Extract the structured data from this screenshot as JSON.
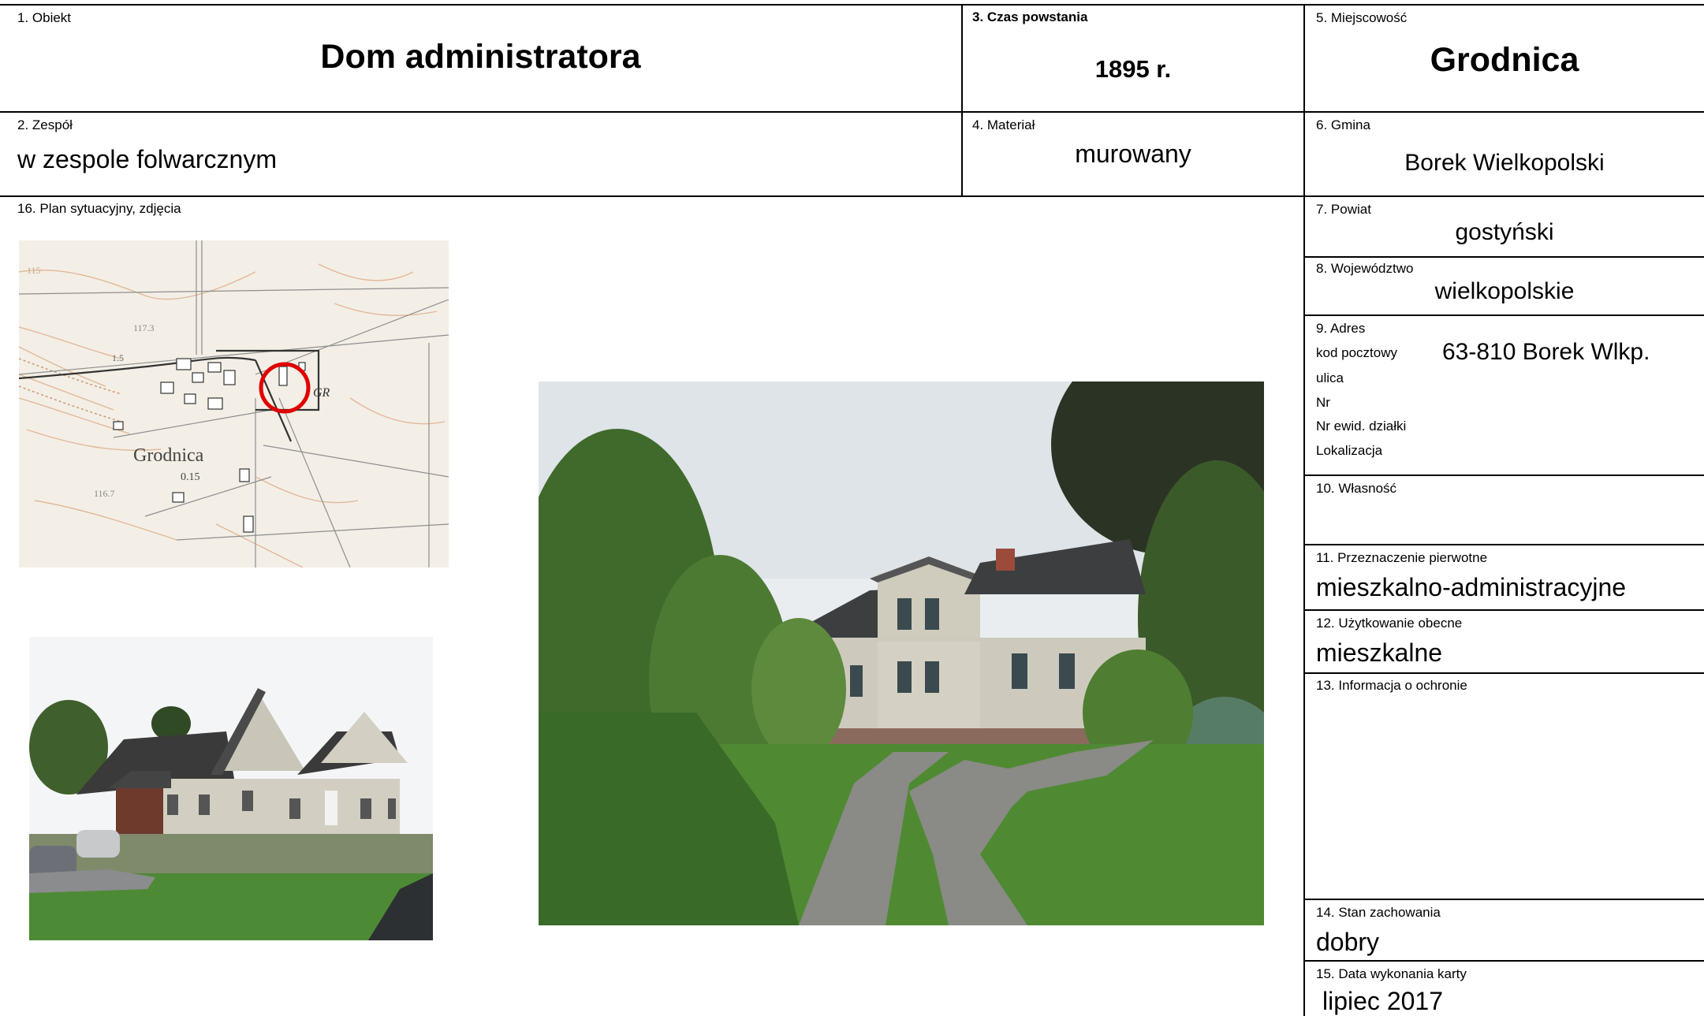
{
  "card": {
    "obiekt_label": "1. Obiekt",
    "obiekt_value": "Dom administratora",
    "czas_label": "3. Czas powstania",
    "czas_value": "1895 r.",
    "miejscowosc_label": "5. Miejscowość",
    "miejscowosc_value": "Grodnica",
    "zespol_label": "2. Zespół",
    "zespol_value": "w zespole folwarcznym",
    "material_label": "4. Materiał",
    "material_value": "murowany",
    "gmina_label": "6. Gmina",
    "gmina_value": "Borek Wielkopolski",
    "plan_label": "16. Plan sytuacyjny, zdjęcia",
    "powiat_label": "7. Powiat",
    "powiat_value": "gostyński",
    "wojewodztwo_label": "8. Województwo",
    "wojewodztwo_value": "wielkopolskie",
    "adres_label": "9. Adres",
    "kod_label": "kod pocztowy",
    "kod_value": "63-810 Borek Wlkp.",
    "ulica_label": "ulica",
    "nr_label": "Nr",
    "dzialki_label": "Nr ewid. działki",
    "lokalizacja_label": "Lokalizacja",
    "wlasnosc_label": "10. Własność",
    "przeznaczenie_label": "11. Przeznaczenie pierwotne",
    "przeznaczenie_value": "mieszkalno-administracyjne",
    "uzytkowanie_label": "12. Użytkowanie obecne",
    "uzytkowanie_value": "mieszkalne",
    "ochrona_label": "13. Informacja o ochronie",
    "stan_label": "14. Stan zachowania",
    "stan_value": "dobry",
    "data_label": "15. Data wykonania karty",
    "data_value": "lipiec  2017"
  },
  "map": {
    "place_label": "Grodnica",
    "number_label": "0.15",
    "elev_1": "117.3",
    "elev_2": "116.7",
    "elev_3": "115",
    "elev_4": "1.5",
    "gr_label": "GR"
  },
  "colors": {
    "border": "#000000",
    "map_bg": "#f3efe6",
    "marker": "#e00000"
  }
}
